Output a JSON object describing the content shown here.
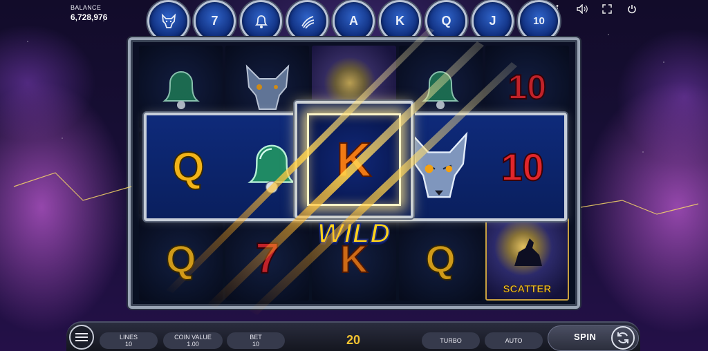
{
  "balance": {
    "label": "BALANCE",
    "value": "6,728,976"
  },
  "top_icons": [
    {
      "name": "info-icon",
      "glyph": "i"
    },
    {
      "name": "sound-icon",
      "glyph": "🔈"
    },
    {
      "name": "fullscreen-icon",
      "glyph": "⛶"
    },
    {
      "name": "power-icon",
      "glyph": "⏻"
    }
  ],
  "paytable": [
    {
      "name": "wolf",
      "text": ""
    },
    {
      "name": "seven",
      "text": "7"
    },
    {
      "name": "bell",
      "text": ""
    },
    {
      "name": "claw",
      "text": ""
    },
    {
      "name": "a",
      "text": "A"
    },
    {
      "name": "k",
      "text": "K"
    },
    {
      "name": "q",
      "text": "Q"
    },
    {
      "name": "j",
      "text": "J"
    },
    {
      "name": "ten",
      "text": "10"
    }
  ],
  "reels": {
    "top_row": [
      "bell",
      "wolf",
      "scatter",
      "bell",
      "10"
    ],
    "win_row": [
      "Q",
      "bell",
      "K",
      "wolf",
      "10"
    ],
    "bottom_row": [
      "Q",
      "7",
      "K",
      "Q",
      "scatter"
    ],
    "highlight_color": "#ffe68c"
  },
  "symbols": {
    "q": "Q",
    "k": "K",
    "ten": "10",
    "seven": "7",
    "wild_label": "WILD",
    "scatter_label": "SCATTER"
  },
  "controls": {
    "lines_label": "LINES",
    "lines_value": "10",
    "coin_value_label": "COIN VALUE",
    "coin_value": "1.00",
    "bet_label": "BET",
    "bet_value": "10",
    "total": "20",
    "turbo_label": "TURBO",
    "auto_label": "AUTO",
    "spin_label": "SPIN"
  }
}
